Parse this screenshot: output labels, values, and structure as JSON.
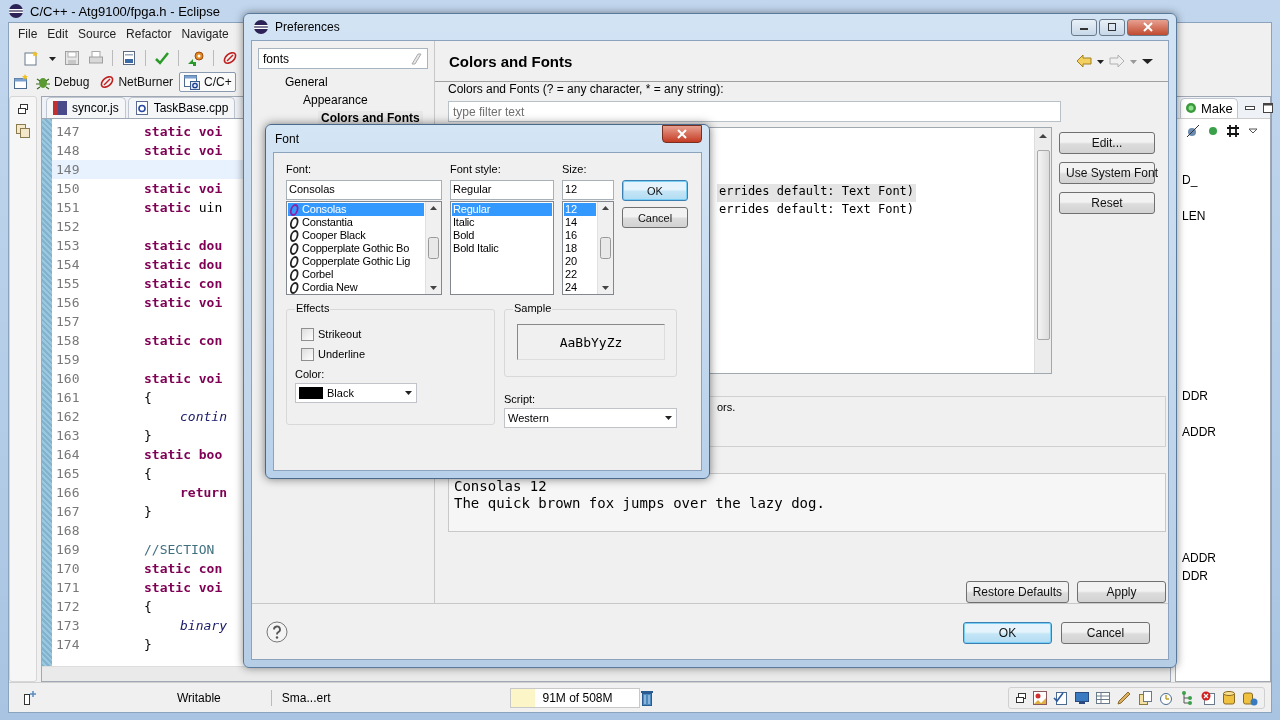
{
  "eclipse": {
    "title": "C/C++ - Atg9100/fpga.h - Eclipse",
    "menu": [
      "File",
      "Edit",
      "Source",
      "Refactor",
      "Navigate"
    ],
    "perspectives": [
      {
        "label": "Debug",
        "kind": "debug",
        "selected": false
      },
      {
        "label": "NetBurner",
        "kind": "netburner",
        "selected": false
      },
      {
        "label": "C/C+",
        "kind": "cpp",
        "selected": true
      }
    ],
    "editor_tabs": [
      {
        "label": "syncor.js",
        "kind": "js",
        "selected": false
      },
      {
        "label": "TaskBase.cpp",
        "kind": "cpp",
        "selected": false
      }
    ],
    "code_lines": [
      {
        "number": "147",
        "kind": "top",
        "current": false,
        "parts": [
          {
            "text": "static voi",
            "kind": "keyword"
          }
        ]
      },
      {
        "number": "148",
        "kind": "top",
        "current": false,
        "parts": [
          {
            "text": "static voi",
            "kind": "keyword"
          }
        ]
      },
      {
        "number": "149",
        "kind": "top",
        "current": true
      },
      {
        "number": "150",
        "kind": "top",
        "current": false,
        "parts": [
          {
            "text": "static voi",
            "kind": "keyword"
          }
        ]
      },
      {
        "number": "151",
        "kind": "top",
        "current": false,
        "parts": [
          {
            "text": "static",
            "kind": "keyword"
          },
          {
            "text": " uin",
            "kind": "plain"
          }
        ]
      },
      {
        "number": "152",
        "kind": "top",
        "current": false
      },
      {
        "number": "153",
        "kind": "top",
        "current": false,
        "parts": [
          {
            "text": "static dou",
            "kind": "keyword"
          }
        ]
      },
      {
        "number": "154",
        "kind": "top",
        "current": false,
        "parts": [
          {
            "text": "static dou",
            "kind": "keyword"
          }
        ]
      },
      {
        "number": "155",
        "kind": "top",
        "current": false,
        "parts": [
          {
            "text": "static con",
            "kind": "keyword"
          }
        ]
      },
      {
        "number": "156",
        "kind": "top",
        "current": false,
        "parts": [
          {
            "text": "static voi",
            "kind": "keyword"
          }
        ]
      },
      {
        "number": "157",
        "kind": "top",
        "current": false
      },
      {
        "number": "158",
        "kind": "top",
        "current": false,
        "parts": [
          {
            "text": "static con",
            "kind": "keyword"
          }
        ]
      },
      {
        "number": "159",
        "kind": "top",
        "current": false
      },
      {
        "number": "160",
        "kind": "top",
        "current": false,
        "parts": [
          {
            "text": "static voi",
            "kind": "keyword"
          }
        ]
      },
      {
        "number": "161",
        "kind": "top",
        "current": false,
        "parts": [
          {
            "text": "{",
            "kind": "plain"
          }
        ]
      },
      {
        "number": "162",
        "kind": "nested",
        "current": false,
        "parts": [
          {
            "text": "contin",
            "kind": "call"
          }
        ]
      },
      {
        "number": "163",
        "kind": "top",
        "current": false,
        "parts": [
          {
            "text": "}",
            "kind": "plain"
          }
        ]
      },
      {
        "number": "164",
        "kind": "top",
        "current": false,
        "parts": [
          {
            "text": "static boo",
            "kind": "keyword"
          }
        ]
      },
      {
        "number": "165",
        "kind": "top",
        "current": false,
        "parts": [
          {
            "text": "{",
            "kind": "plain"
          }
        ]
      },
      {
        "number": "166",
        "kind": "nested",
        "current": false,
        "parts": [
          {
            "text": "return",
            "kind": "keyword"
          }
        ]
      },
      {
        "number": "167",
        "kind": "top",
        "current": false,
        "parts": [
          {
            "text": "}",
            "kind": "plain"
          }
        ]
      },
      {
        "number": "168",
        "kind": "top",
        "current": false
      },
      {
        "number": "169",
        "kind": "top",
        "current": false,
        "parts": [
          {
            "text": "//SECTION",
            "kind": "comment"
          }
        ]
      },
      {
        "number": "170",
        "kind": "top",
        "current": false,
        "parts": [
          {
            "text": "static con",
            "kind": "keyword"
          }
        ]
      },
      {
        "number": "171",
        "kind": "top",
        "current": false,
        "parts": [
          {
            "text": "static voi",
            "kind": "keyword"
          }
        ]
      },
      {
        "number": "172",
        "kind": "top",
        "current": false,
        "parts": [
          {
            "text": "{",
            "kind": "plain"
          }
        ]
      },
      {
        "number": "173",
        "kind": "nested",
        "current": false,
        "parts": [
          {
            "text": "binary",
            "kind": "call"
          }
        ]
      },
      {
        "number": "174",
        "kind": "top",
        "current": false,
        "parts": [
          {
            "text": "}",
            "kind": "plain"
          }
        ]
      }
    ],
    "right_panel": {
      "tab": "Make",
      "lines": [
        "D_",
        "LEN",
        "DDR",
        "ADDR",
        "ADDR",
        "DDR"
      ]
    },
    "status_bar": {
      "mode": "Writable",
      "insert": "Sma...ert",
      "memory": "91M of 508M",
      "level": 0.18
    }
  },
  "preferences": {
    "title": "Preferences",
    "filter": "fonts",
    "tree": [
      {
        "label": "General",
        "selected": false,
        "children": [
          {
            "label": "Appearance",
            "selected": false,
            "children": [
              {
                "label": "Colors and Fonts",
                "selected": true
              }
            ]
          }
        ]
      }
    ],
    "page_title": "Colors and Fonts",
    "filter_label": "Colors and Fonts (? = any character, * = any string):",
    "filter_placeholder": "type filter text",
    "font_items": [
      {
        "text": "errides default: Text Font)",
        "selected": true
      },
      {
        "text": "errides default: Text Font)",
        "selected": false
      }
    ],
    "side_buttons": [
      "Edit...",
      "Use System Font",
      "Reset"
    ],
    "description": "ors.",
    "preview": [
      "Consolas 12",
      "The quick brown fox jumps over the lazy dog."
    ],
    "page_buttons": [
      "Restore Defaults",
      "Apply"
    ],
    "dialog_buttons": [
      {
        "label": "OK",
        "default": true
      },
      {
        "label": "Cancel",
        "default": false
      }
    ]
  },
  "font_dialog": {
    "title": "Font",
    "font_label": "Font:",
    "font_value": "Consolas",
    "fonts": [
      {
        "label": "Consolas",
        "selected": true
      },
      {
        "label": "Constantia",
        "selected": false
      },
      {
        "label": "Cooper Black",
        "selected": false
      },
      {
        "label": "Copperplate Gothic Bo",
        "selected": false
      },
      {
        "label": "Copperplate Gothic Lig",
        "selected": false
      },
      {
        "label": "Corbel",
        "selected": false
      },
      {
        "label": "Cordia New",
        "selected": false
      }
    ],
    "style_label": "Font style:",
    "style_value": "Regular",
    "styles": [
      {
        "label": "Regular",
        "selected": true
      },
      {
        "label": "Italic",
        "selected": false
      },
      {
        "label": "Bold",
        "selected": false
      },
      {
        "label": "Bold Italic",
        "selected": false
      }
    ],
    "size_label": "Size:",
    "size_value": "12",
    "sizes": [
      {
        "label": "12",
        "selected": true
      },
      {
        "label": "14",
        "selected": false
      },
      {
        "label": "16",
        "selected": false
      },
      {
        "label": "18",
        "selected": false
      },
      {
        "label": "20",
        "selected": false
      },
      {
        "label": "22",
        "selected": false
      },
      {
        "label": "24",
        "selected": false
      }
    ],
    "buttons": [
      {
        "label": "OK",
        "default": true
      },
      {
        "label": "Cancel",
        "default": false
      }
    ],
    "effects_label": "Effects",
    "effects": [
      {
        "label": "Strikeout",
        "checked": false
      },
      {
        "label": "Underline",
        "checked": false
      }
    ],
    "color_label": "Color:",
    "color_value": "Black",
    "color": "#000000",
    "sample_label": "Sample",
    "sample": "AaBbYyZz",
    "script_label": "Script:",
    "script": "Western"
  }
}
